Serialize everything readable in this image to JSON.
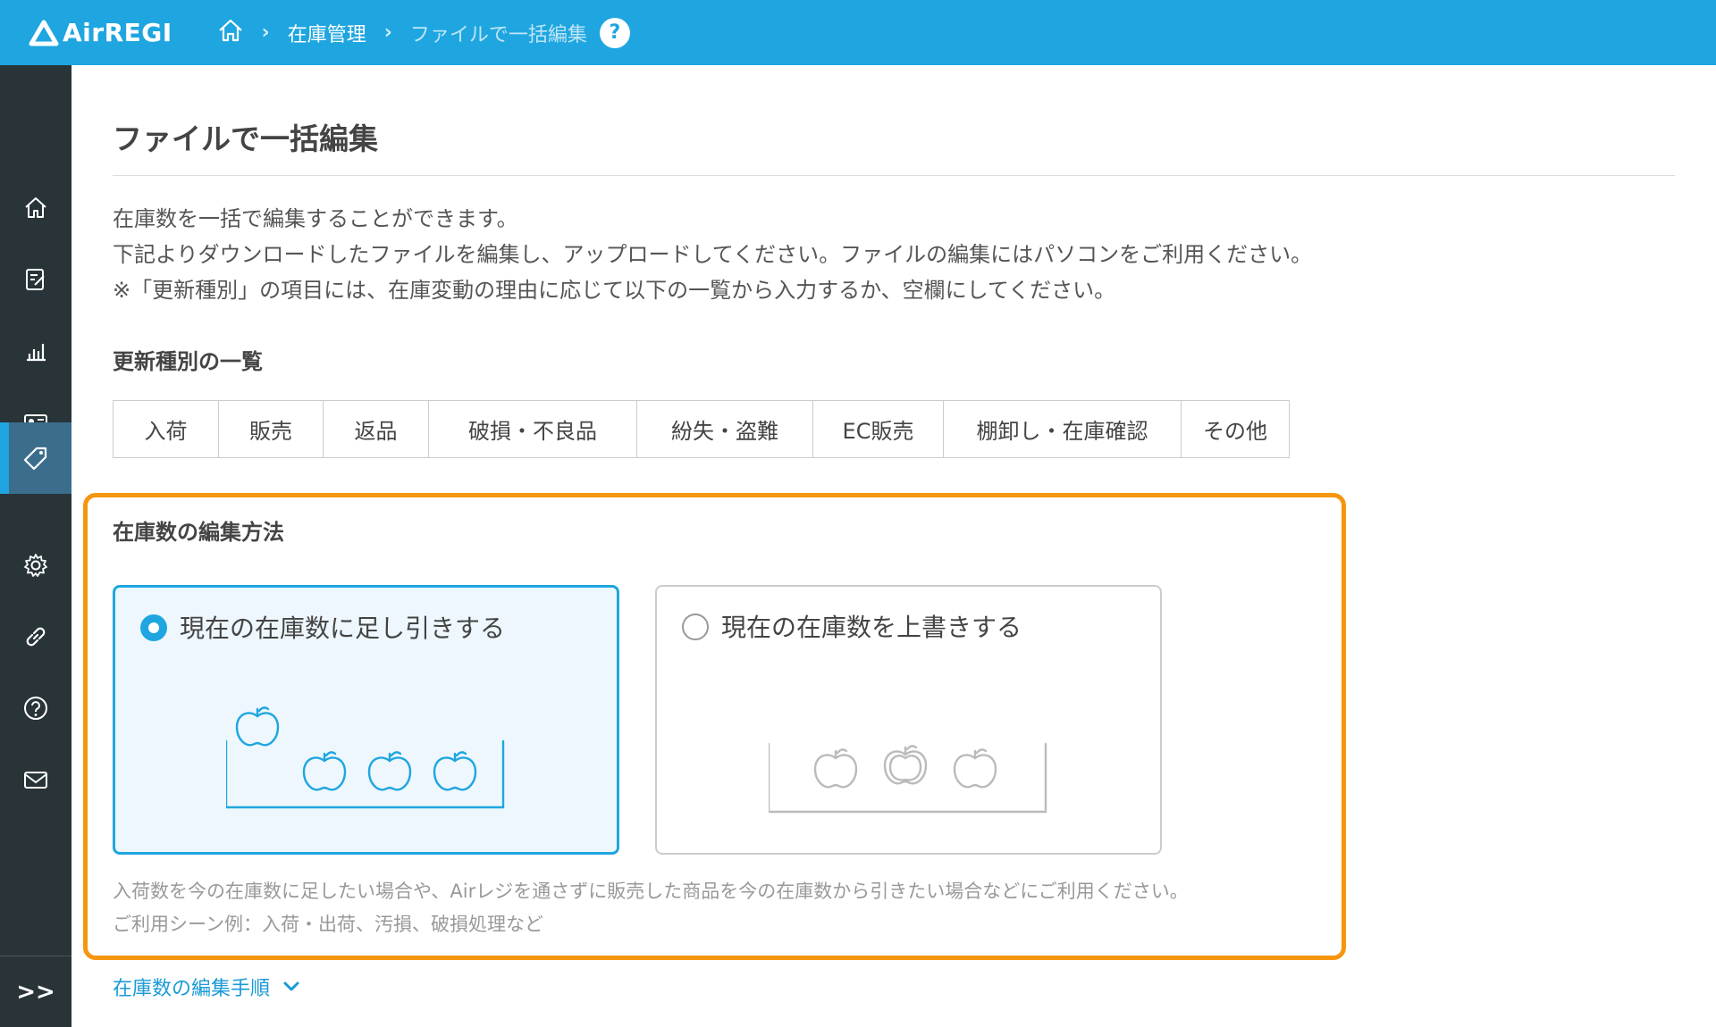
{
  "header": {
    "logo_text": "AirREGI",
    "breadcrumb": {
      "home_icon": "home-icon",
      "level1": "在庫管理",
      "current": "ファイルで一括編集",
      "help": "?"
    },
    "brand_color": "#1fa6e0"
  },
  "sidebar": {
    "items": [
      {
        "icon": "home-icon"
      },
      {
        "icon": "edit-note-icon"
      },
      {
        "icon": "bar-chart-icon"
      },
      {
        "icon": "customer-card-icon"
      },
      {
        "icon": "tag-icon",
        "active": true
      },
      {
        "icon": "gear-icon"
      },
      {
        "icon": "link-icon"
      },
      {
        "icon": "help-circle-icon"
      },
      {
        "icon": "mail-icon"
      }
    ],
    "expand_label": ">>"
  },
  "main": {
    "title": "ファイルで一括編集",
    "description": [
      "在庫数を一括で編集することができます。",
      "下記よりダウンロードしたファイルを編集し、アップロードしてください。ファイルの編集にはパソコンをご利用ください。",
      "※「更新種別」の項目には、在庫変動の理由に応じて以下の一覧から入力するか、空欄にしてください。"
    ],
    "update_types_heading": "更新種別の一覧",
    "update_types": [
      "入荷",
      "販売",
      "返品",
      "破損・不良品",
      "紛失・盗難",
      "EC販売",
      "棚卸し・在庫確認",
      "その他"
    ],
    "edit_method": {
      "heading": "在庫数の編集方法",
      "options": [
        {
          "label": "現在の在庫数に足し引きする",
          "selected": true
        },
        {
          "label": "現在の在庫数を上書きする",
          "selected": false
        }
      ],
      "note_lines": [
        "入荷数を今の在庫数に足したい場合や、Airレジを通さずに販売した商品を今の在庫数から引きたい場合などにご利用ください。",
        "ご利用シーン例：入荷・出荷、汚損、破損処理など"
      ],
      "highlight_color": "#f6950e"
    },
    "steps_link": "在庫数の編集手順"
  }
}
